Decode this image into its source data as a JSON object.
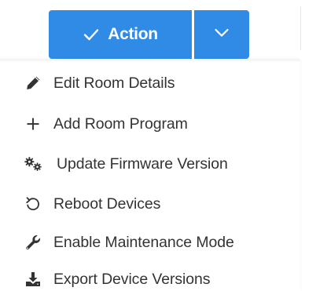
{
  "action_button": {
    "label": "Action",
    "check_icon": "check-icon",
    "toggle_icon": "chevron-down-icon",
    "color": "#2f8be6"
  },
  "menu": {
    "items": [
      {
        "label": "Edit Room Details",
        "icon": "pencil-icon"
      },
      {
        "label": "Add Room Program",
        "icon": "plus-icon"
      },
      {
        "label": "Update Firmware Version",
        "icon": "gears-icon"
      },
      {
        "label": "Reboot Devices",
        "icon": "undo-icon"
      },
      {
        "label": "Enable Maintenance Mode",
        "icon": "wrench-icon"
      },
      {
        "label": "Export Device Versions",
        "icon": "download-icon"
      }
    ]
  }
}
